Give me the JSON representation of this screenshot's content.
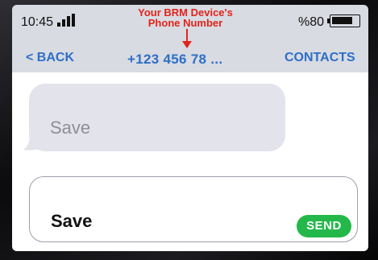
{
  "status_bar": {
    "time": "10:45",
    "battery_text": "%80",
    "battery_level": 0.8,
    "signal_icon": "signal-bars-icon"
  },
  "annotation": {
    "text_line1": "Your BRM Device's",
    "text_line2": "Phone Number",
    "color": "#e0241b",
    "arrow_icon": "arrow-down-icon"
  },
  "nav": {
    "back_label": "< BACK",
    "recipient_number": "+123 456 78 ...",
    "contacts_label": "CONTACTS",
    "accent_color": "#2d6fc6"
  },
  "thread": {
    "messages": [
      {
        "text": "Save"
      }
    ]
  },
  "composer": {
    "text": "Save",
    "send_label": "SEND",
    "send_color": "#24b84a"
  }
}
